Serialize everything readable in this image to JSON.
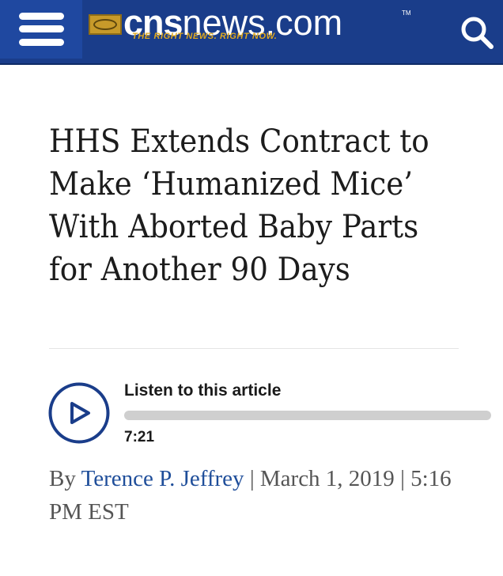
{
  "header": {
    "brand_cns": "cns",
    "brand_rest": "news.com",
    "trademark": "TM",
    "tagline": "THE RIGHT NEWS. RIGHT NOW.",
    "menu_icon": "hamburger-menu-icon",
    "search_icon": "search-icon"
  },
  "article": {
    "title": "HHS Extends Contract to Make ‘Humanized Mice’ With Aborted Baby Parts for Another 90 Days"
  },
  "audio_player": {
    "label": "Listen to this article",
    "duration": "7:21",
    "progress": 0,
    "play_icon": "play-icon"
  },
  "byline": {
    "prefix": "By ",
    "author": "Terence P. Jeffrey",
    "sep1": " | ",
    "date": "March 1, 2019",
    "sep2": " | ",
    "time": "5:16 PM EST"
  },
  "colors": {
    "header_bg": "#1a3d8a",
    "menu_bg": "#1f48a0",
    "tagline": "#e0a91f",
    "link": "#1f4e9a",
    "play_ring": "#1a3d8a"
  }
}
